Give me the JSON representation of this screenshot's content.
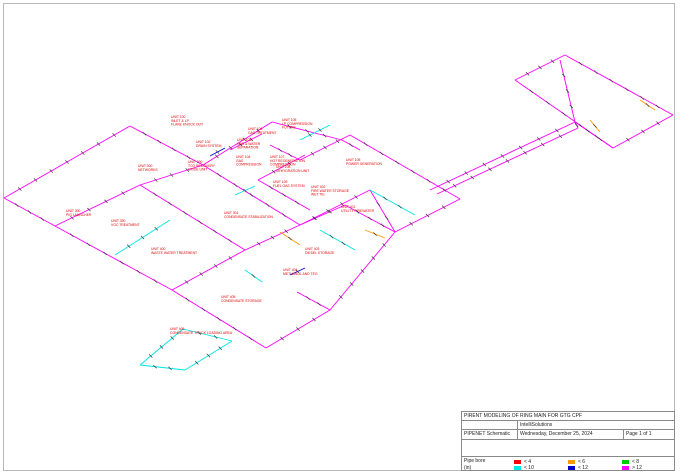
{
  "title_block": {
    "title": "PIRENT MODELING OF RING MAIN FOR GTG CPF",
    "company": "IntelliSolutions",
    "app": "PIPENET Schematic",
    "date": "Wednesday, December 25, 2024",
    "page": "Page 1 of 1",
    "legend_title": "Pipe bore",
    "legend_unit": "(in)"
  },
  "legend": [
    {
      "label": "< 4",
      "color": "#ff0000"
    },
    {
      "label": "< 6",
      "color": "#ff9900"
    },
    {
      "label": "< 8",
      "color": "#00cc00"
    },
    {
      "label": "< 10",
      "color": "#00e5e5"
    },
    {
      "label": "< 12",
      "color": "#0000cc"
    },
    {
      "label": "> 12",
      "color": "#ff00ff"
    }
  ],
  "units": [
    {
      "line1": "UNIT 100",
      "line2": "INLET & LP\nFLARE KNOCK OUT"
    },
    {
      "line1": "UNIT 102",
      "line2": "DRAIN SYSTEM"
    },
    {
      "line1": "UNIT 103",
      "line2": "GAS & WATER\nSEPARATION"
    },
    {
      "line1": "UNIT 104",
      "line2": "GAS\nCOMPRESSION"
    },
    {
      "line1": "UNIT 105",
      "line2": "LP COMPRESSION\nFUTURE"
    },
    {
      "line1": "UNIT 106",
      "line2": "GAS TREATMENT"
    },
    {
      "line1": "UNIT 107",
      "line2": "HOT REGENERATION\nCOMPRESSION"
    },
    {
      "line1": "UNIT 108",
      "line2": "DEHYDRATION UNIT"
    },
    {
      "line1": "UNIT 109",
      "line2": "FUEL GAS SYSTEM"
    },
    {
      "line1": "UNIT 105",
      "line2": "POWER GENERATION"
    },
    {
      "line1": "UNIT 300",
      "line2": "PIG LAUNCHER"
    },
    {
      "line1": "UNIT 300",
      "line2": "NETWORKS"
    },
    {
      "line1": "UNIT 200",
      "line2": "TCO RECOVERY\nOXIDE UNIT"
    },
    {
      "line1": "UNIT 390",
      "line2": "VOC TREATMENT"
    },
    {
      "line1": "UNIT 400",
      "line2": "WASTE WATER TREATMENT"
    },
    {
      "line1": "UNIT 301",
      "line2": "CONDENSATE STABILIZATION"
    },
    {
      "line1": "UNIT 401",
      "line2": "UTILITY FIREWATER"
    },
    {
      "line1": "UNIT 402",
      "line2": "FIRE WATER STORAGE\nWET TIE"
    },
    {
      "line1": "UNIT 403",
      "line2": "DIESEL STORAGE"
    },
    {
      "line1": "UNIT 404",
      "line2": "METHANOL AND TEG"
    },
    {
      "line1": "UNIT 405",
      "line2": "CONDENSATE STORAGE"
    },
    {
      "line1": "UNIT 406",
      "line2": "CONDENSATE TRUCK LOADING AREA"
    }
  ]
}
